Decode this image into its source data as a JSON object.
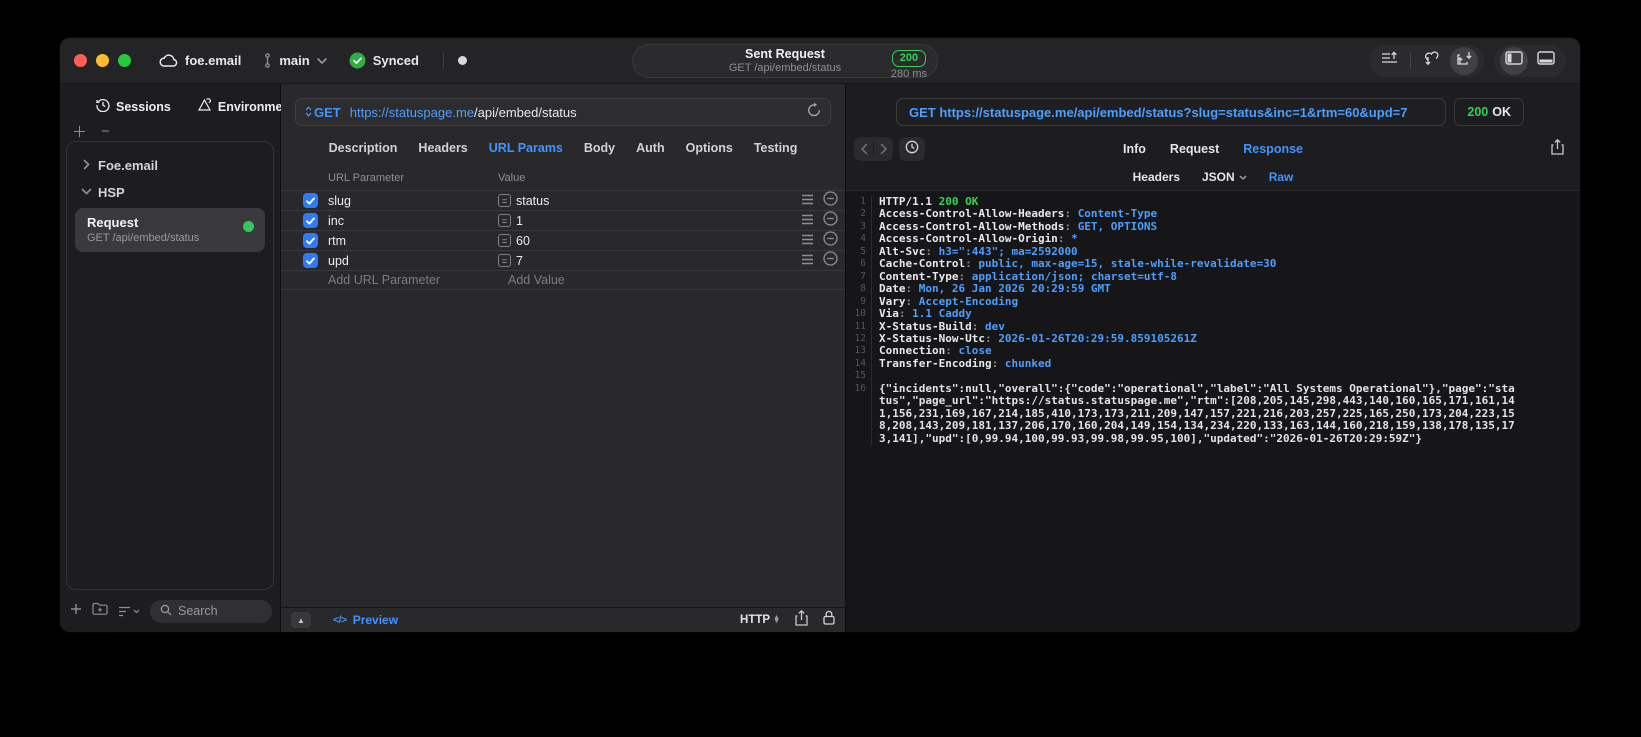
{
  "colors": {
    "accent_blue": "#3f95ff",
    "link_blue": "#4b9fff",
    "success_green": "#30d158",
    "checkbox_blue": "#2f7bf7",
    "traffic_red": "#ff5f57",
    "traffic_yellow": "#febc2e",
    "traffic_green": "#28c840"
  },
  "titlebar": {
    "project": "foe.email",
    "branch": "main",
    "sync_status": "Synced",
    "title": "Sent Request",
    "subtitle": "GET /api/embed/status",
    "status_code": "200",
    "duration": "280 ms",
    "icons": [
      "cloud-icon",
      "branch-icon",
      "chevron-down-icon",
      "synced-check-icon",
      "recording-dot",
      "publish-icon",
      "pull-icon",
      "import-icon",
      "sidebar-toggle-icon",
      "bottom-panel-toggle-icon"
    ]
  },
  "sidebar": {
    "tabs": [
      {
        "label": "Sessions",
        "icon": "clock-icon"
      },
      {
        "label": "Environments",
        "icon": "environments-icon"
      }
    ],
    "tree": [
      {
        "label": "Foe.email",
        "expanded": false
      },
      {
        "label": "HSP",
        "expanded": true
      }
    ],
    "request_item": {
      "title": "Request",
      "subtitle": "GET /api/embed/status",
      "status_dot": "green"
    },
    "search_placeholder": "Search"
  },
  "request_editor": {
    "method": "GET",
    "url_host": "https://statuspage.me",
    "url_path": "/api/embed/status",
    "tabs": [
      "Description",
      "Headers",
      "URL Params",
      "Body",
      "Auth",
      "Options",
      "Testing"
    ],
    "active_tab": "URL Params",
    "params": {
      "col_name": "URL Parameter",
      "col_value": "Value",
      "rows": [
        {
          "name": "slug",
          "value": "status",
          "checked": true
        },
        {
          "name": "inc",
          "value": "1",
          "checked": true
        },
        {
          "name": "rtm",
          "value": "60",
          "checked": true
        },
        {
          "name": "upd",
          "value": "7",
          "checked": true
        }
      ],
      "add_name_placeholder": "Add URL Parameter",
      "add_value_placeholder": "Add Value"
    },
    "footer": {
      "preview_label": "Preview",
      "code_glyph": "</>",
      "http_label": "HTTP"
    }
  },
  "response_viewer": {
    "request_line": "GET https://statuspage.me/api/embed/status?slug=status&inc=1&rtm=60&upd=7",
    "status_code": "200",
    "status_text": "OK",
    "tabs": [
      "Info",
      "Request",
      "Response"
    ],
    "active_tab": "Response",
    "subtabs": [
      "Headers",
      "JSON",
      "Raw"
    ],
    "active_subtab": "Raw",
    "status_line": {
      "protocol": "HTTP/1.1",
      "status": "200 OK"
    },
    "headers": [
      {
        "name": "Access-Control-Allow-Headers",
        "value": "Content-Type"
      },
      {
        "name": "Access-Control-Allow-Methods",
        "value": "GET, OPTIONS"
      },
      {
        "name": "Access-Control-Allow-Origin",
        "value": "*"
      },
      {
        "name": "Alt-Svc",
        "value": "h3=\":443\"; ma=2592000"
      },
      {
        "name": "Cache-Control",
        "value": "public, max-age=15, stale-while-revalidate=30"
      },
      {
        "name": "Content-Type",
        "value": "application/json; charset=utf-8"
      },
      {
        "name": "Date",
        "value": "Mon, 26 Jan 2026 20:29:59 GMT"
      },
      {
        "name": "Vary",
        "value": "Accept-Encoding"
      },
      {
        "name": "Via",
        "value": "1.1 Caddy"
      },
      {
        "name": "X-Status-Build",
        "value": "dev"
      },
      {
        "name": "X-Status-Now-Utc",
        "value": "2026-01-26T20:29:59.859105261Z"
      },
      {
        "name": "Connection",
        "value": "close"
      },
      {
        "name": "Transfer-Encoding",
        "value": "chunked"
      }
    ],
    "body": "{\"incidents\":null,\"overall\":{\"code\":\"operational\",\"label\":\"All Systems Operational\"},\"page\":\"status\",\"page_url\":\"https://status.statuspage.me\",\"rtm\":[208,205,145,298,443,140,160,165,171,161,141,156,231,169,167,214,185,410,173,173,211,209,147,157,221,216,203,257,225,165,250,173,204,223,158,208,143,209,181,137,206,170,160,204,149,154,134,234,220,133,163,144,160,218,159,138,178,135,173,141],\"upd\":[0,99.94,100,99.93,99.98,99.95,100],\"updated\":\"2026-01-26T20:29:59Z\"}"
  }
}
